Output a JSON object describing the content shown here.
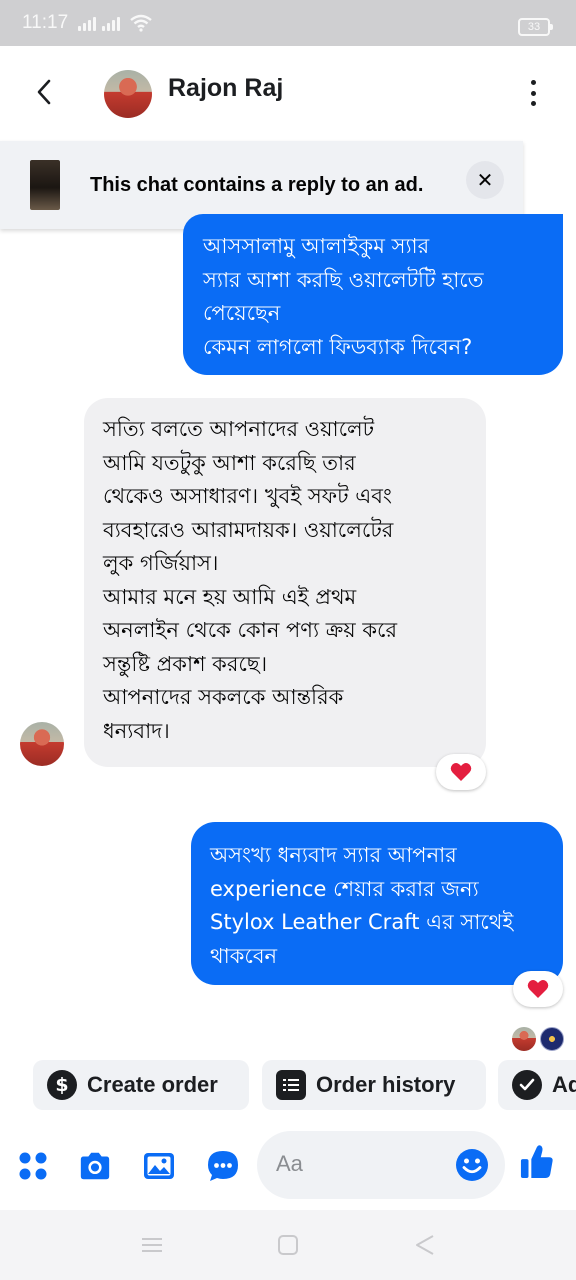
{
  "status_bar": {
    "time": "11:17",
    "battery": "33"
  },
  "header": {
    "contact_name": "Rajon Raj"
  },
  "ad_banner": {
    "text": "This chat contains a reply to an ad.",
    "close_symbol": "✕"
  },
  "messages": [
    {
      "direction": "outgoing",
      "text": "আসসালামু আলাইকুম স্যার\nস্যার আশা করছি ওয়ালেটটি হাতে\nপেয়েছেন\nকেমন লাগলো ফিডব্যাক দিবেন?"
    },
    {
      "direction": "incoming",
      "text": "সত্যি বলতে আপনাদের ওয়ালেট\nআমি যতটুকু আশা করেছি  তার\nথেকেও অসাধারণ। খুবই সফট এবং\nব্যবহারেও আরামদায়ক।  ওয়ালেটের\nলুক গর্জিয়াস।\nআমার মনে হয় আমি এই প্রথম\nঅনলাইন থেকে কোন পণ্য ক্রয় করে\nসন্তুষ্টি প্রকাশ করছে।\nআপনাদের সকলকে আন্তরিক\nধন্যবাদ।",
      "reaction": "heart"
    },
    {
      "direction": "outgoing",
      "text": "অসংখ্য ধন্যবাদ স্যার আপনার\nexperience শেয়ার করার জন্য\nStylox Leather Craft এর সাথেই\nথাকবেন",
      "reaction": "heart"
    }
  ],
  "quick_actions": [
    {
      "label": "Create order",
      "icon": "dollar-icon"
    },
    {
      "label": "Order history",
      "icon": "list-icon"
    },
    {
      "label": "Ad",
      "icon": "check-circle-icon"
    }
  ],
  "composer": {
    "placeholder": "Aa"
  },
  "colors": {
    "accent": "#0a6cf5",
    "incoming_bubble": "#f0f0f2",
    "heart": "#e41e3f",
    "status_bar": "#cfcfd1"
  }
}
